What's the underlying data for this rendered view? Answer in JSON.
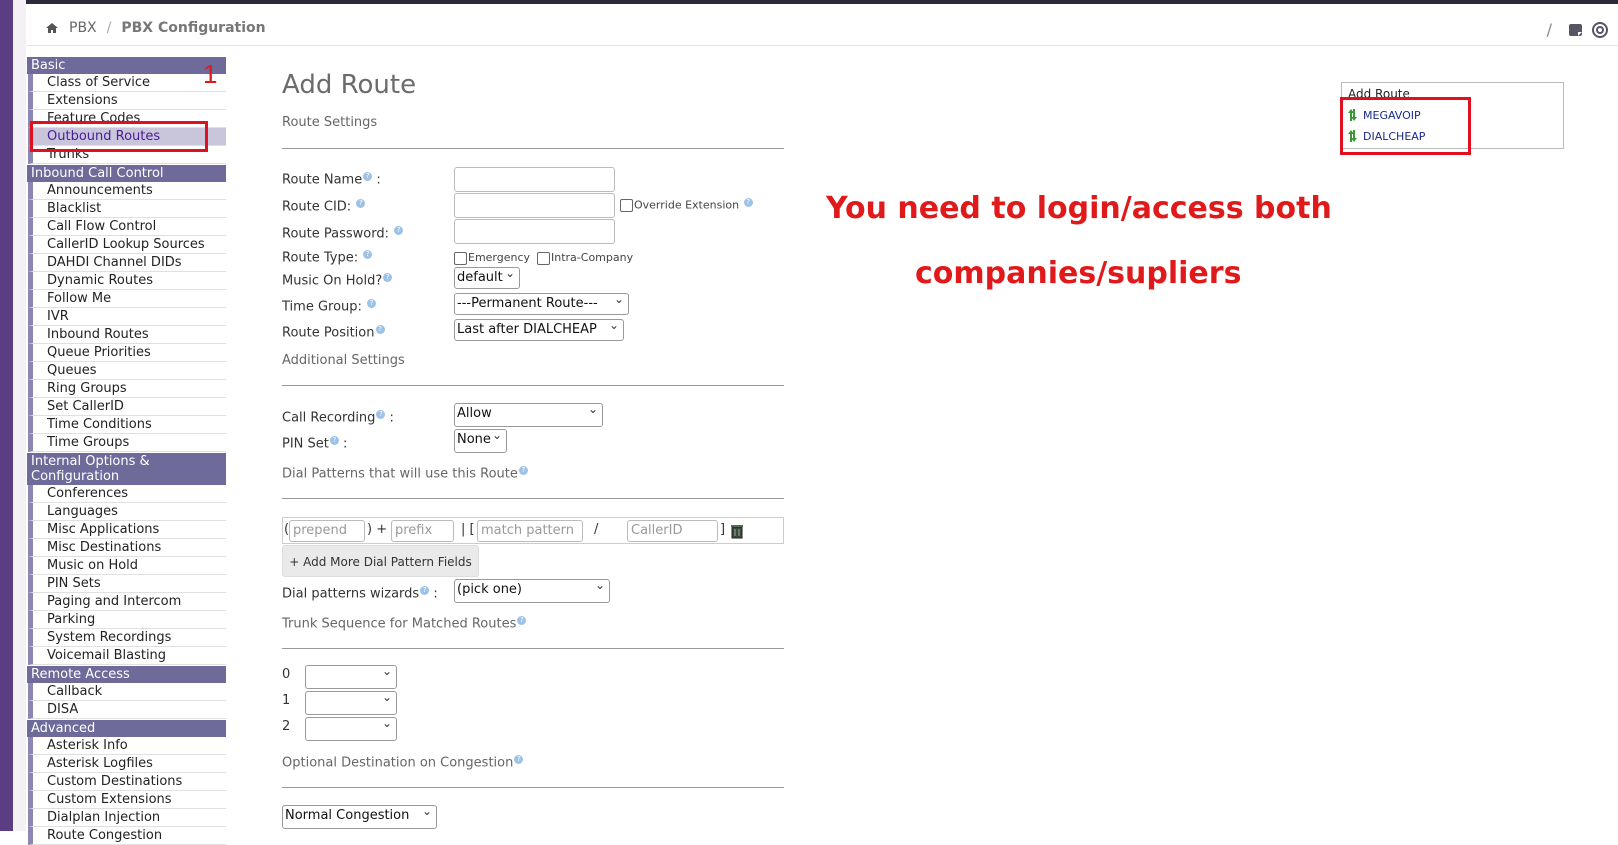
{
  "breadcrumb": {
    "home": "",
    "sep": "/",
    "pbx": "PBX",
    "current": "PBX Configuration"
  },
  "header_right": {
    "sep": "/"
  },
  "sidebar": {
    "basic": {
      "title": "Basic",
      "items": [
        "Class of Service",
        "Extensions",
        "Feature Codes",
        "Outbound Routes",
        "Trunks"
      ]
    },
    "inbound": {
      "title": "Inbound Call Control",
      "items": [
        "Announcements",
        "Blacklist",
        "Call Flow Control",
        "CallerID Lookup Sources",
        "DAHDI Channel DIDs",
        "Dynamic Routes",
        "Follow Me",
        "IVR",
        "Inbound Routes",
        "Queue Priorities",
        "Queues",
        "Ring Groups",
        "Set CallerID",
        "Time Conditions",
        "Time Groups"
      ]
    },
    "internal": {
      "title": "Internal Options & Configuration",
      "items": [
        "Conferences",
        "Languages",
        "Misc Applications",
        "Misc Destinations",
        "Music on Hold",
        "PIN Sets",
        "Paging and Intercom",
        "Parking",
        "System Recordings",
        "Voicemail Blasting"
      ]
    },
    "remote": {
      "title": "Remote Access",
      "items": [
        "Callback",
        "DISA"
      ]
    },
    "advanced": {
      "title": "Advanced",
      "items": [
        "Asterisk Info",
        "Asterisk Logfiles",
        "Custom Destinations",
        "Custom Extensions",
        "Dialplan Injection",
        "Route Congestion"
      ]
    }
  },
  "main": {
    "title": "Add Route",
    "route_settings": "Route Settings",
    "route_name": "Route Name",
    "route_cid": "Route CID:",
    "override_extension": "Override Extension",
    "route_password": "Route Password:",
    "route_type": "Route Type:",
    "emergency": "Emergency",
    "intra_company": "Intra-Company",
    "music_on_hold": "Music On Hold?",
    "music_on_hold_value": "default",
    "time_group": "Time Group:",
    "time_group_value": "---Permanent Route---",
    "route_position": "Route Position",
    "route_position_value": "Last after DIALCHEAP",
    "additional_settings": "Additional Settings",
    "call_recording": "Call Recording",
    "call_recording_value": "Allow",
    "pin_set": "PIN Set",
    "pin_set_value": "None",
    "dial_patterns_title": "Dial Patterns that will use this Route",
    "prepend_ph": "prepend",
    "prefix_ph": "prefix",
    "match_ph": "match pattern",
    "callerid_ph": "CallerID",
    "add_more": "+ Add More Dial Pattern Fields",
    "wizards": "Dial patterns wizards",
    "wizards_value": "(pick one)",
    "trunk_seq": "Trunk Sequence for Matched Routes",
    "trunk_rows": [
      "0",
      "1",
      "2"
    ],
    "optional_dest": "Optional Destination on Congestion",
    "congestion_value": "Normal Congestion"
  },
  "routes_box": {
    "title": "Add Route",
    "routes": [
      "MEGAVOIP",
      "DIALCHEAP"
    ]
  },
  "annotation": {
    "line1": "You need to login/access both",
    "line2": "companies/supliers",
    "number": "1"
  },
  "colors": {
    "annotation_red": "#e01020",
    "sidebar_category": "#6e6a9a"
  }
}
